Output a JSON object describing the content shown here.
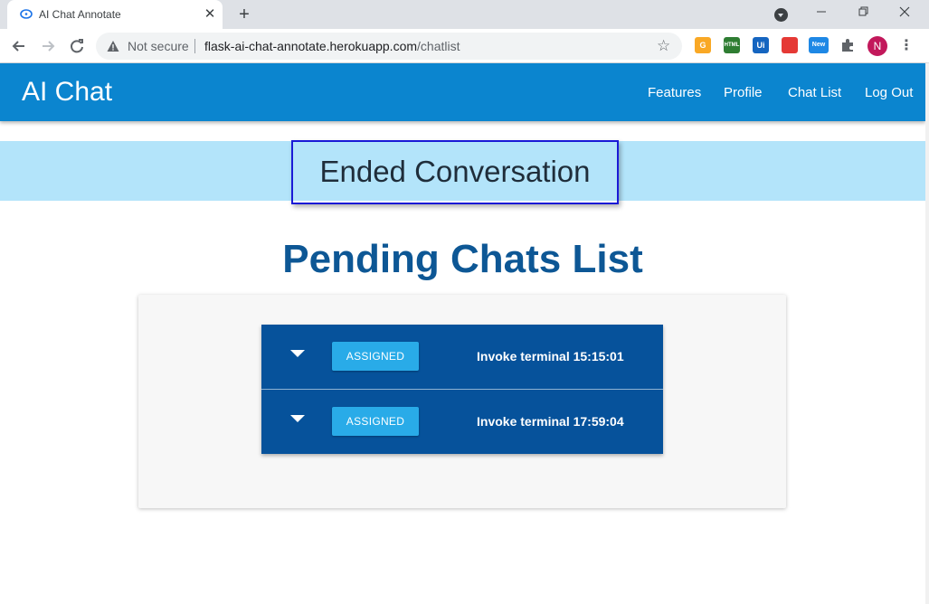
{
  "browser": {
    "tab_title": "AI Chat Annotate",
    "tab_close": "✕",
    "new_tab": "+",
    "security_label": "Not secure",
    "url_host": "flask-ai-chat-annotate.herokuapp.com",
    "url_path": "/chatlist",
    "profile_initial": "N",
    "extensions": [
      {
        "name": "g-extension-icon",
        "label": "G",
        "color": "#f9a825"
      },
      {
        "name": "html-extension-icon",
        "label": "HTML",
        "color": "#2e7d32"
      },
      {
        "name": "ui-extension-icon",
        "label": "Ui",
        "color": "#1565c0"
      },
      {
        "name": "color-extension-icon",
        "label": "",
        "color": "#e53935"
      },
      {
        "name": "new-extension-icon",
        "label": "New",
        "color": "#1e88e5"
      }
    ]
  },
  "app": {
    "brand": "AI Chat",
    "nav": [
      "Features",
      "Profile",
      "Chat List",
      "Log Out"
    ],
    "banner": "Ended Conversation",
    "title": "Pending Chats List",
    "chats": [
      {
        "status": "ASSIGNED",
        "name": "Invoke terminal 15:15:01"
      },
      {
        "status": "ASSIGNED",
        "name": "Invoke terminal 17:59:04"
      }
    ]
  },
  "colors": {
    "appbar": "#0b85cf",
    "banner": "#b3e4fa",
    "row": "#06529b",
    "badge": "#29abe8",
    "title": "#0d5795"
  }
}
